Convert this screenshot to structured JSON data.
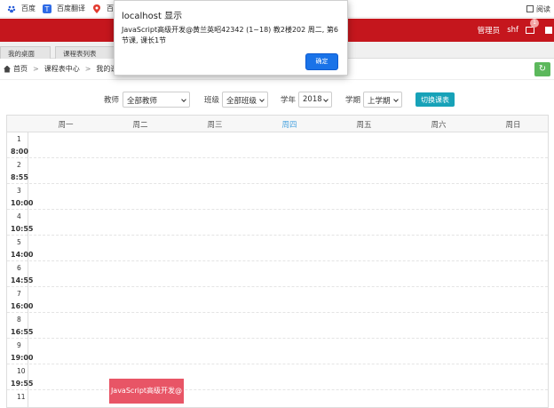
{
  "bookmarks": [
    {
      "label": "百度",
      "icon": "baidu-paw-icon"
    },
    {
      "label": "百度翻译",
      "icon": "translate-icon"
    },
    {
      "label": "百度",
      "icon": "map-pin-icon"
    }
  ],
  "bookmarks_right": "阅读",
  "header": {
    "role": "管理员",
    "username": "shf",
    "mail_badge": "1",
    "brand_color": "#c5161d"
  },
  "tabs": [
    "我的桌面",
    "课程表列表"
  ],
  "breadcrumb": [
    "首页",
    "课程表中心",
    "我的课"
  ],
  "filters": {
    "teacher_label": "教师",
    "teacher_value": "全部教师",
    "class_label": "班级",
    "class_value": "全部班级",
    "year_label": "学年",
    "year_value": "2018",
    "term_label": "学期",
    "term_value": "上学期",
    "switch_button": "切换课表"
  },
  "calendar": {
    "days": [
      "周一",
      "周二",
      "周三",
      "周四",
      "周五",
      "周六",
      "周日"
    ],
    "today_index": 3,
    "slots": [
      {
        "num": "1",
        "time": "8:00"
      },
      {
        "num": "2",
        "time": "8:55"
      },
      {
        "num": "3",
        "time": "10:00"
      },
      {
        "num": "4",
        "time": "10:55"
      },
      {
        "num": "5",
        "time": "14:00"
      },
      {
        "num": "6",
        "time": "14:55"
      },
      {
        "num": "7",
        "time": "16:00"
      },
      {
        "num": "8",
        "time": "16:55"
      },
      {
        "num": "9",
        "time": "19:00"
      },
      {
        "num": "10",
        "time": "19:55"
      },
      {
        "num": "11",
        "time": ""
      }
    ],
    "event": {
      "label": "JavaScript高级开发@",
      "color": "#e85566"
    }
  },
  "dialog": {
    "title": "localhost 显示",
    "message": "JavaScript高级开发@黄兰英昭42342 (1~18)  教2楼202  周二, 第6节课, 课长1节",
    "ok_label": "确定"
  }
}
